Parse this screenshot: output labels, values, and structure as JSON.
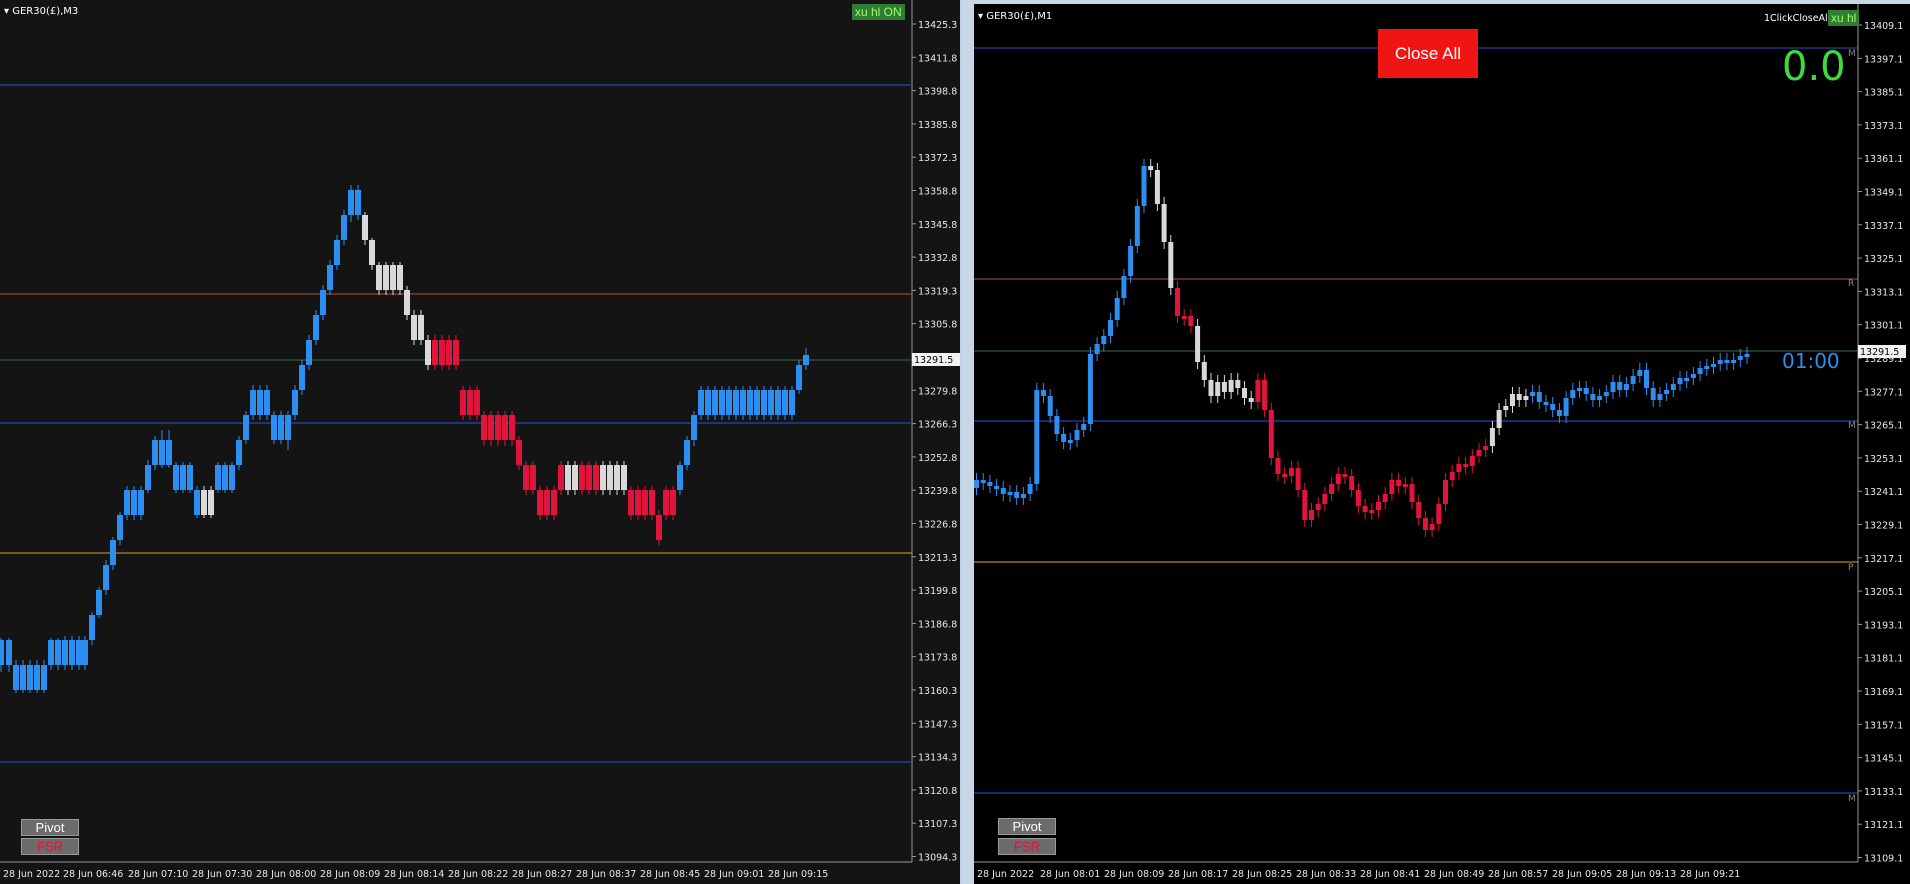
{
  "charts": [
    {
      "title": "GER30(£),M3",
      "bg": "#141414",
      "y_ticks": [
        "13425.3",
        "13411.8",
        "13398.8",
        "13385.8",
        "13372.3",
        "13358.8",
        "13345.8",
        "13332.8",
        "13319.3",
        "13305.8",
        "13291.5",
        "13279.8",
        "13266.3",
        "13252.8",
        "13239.8",
        "13226.8",
        "13213.3",
        "13199.8",
        "13186.8",
        "13173.8",
        "13160.3",
        "13147.3",
        "13134.3",
        "13120.8",
        "13107.3",
        "13094.3"
      ],
      "price_label": "13291.5",
      "x_ticks": [
        "28 Jun 2022",
        "28 Jun 06:46",
        "28 Jun 07:10",
        "28 Jun 07:30",
        "28 Jun 08:00",
        "28 Jun 08:09",
        "28 Jun 08:14",
        "28 Jun 08:22",
        "28 Jun 08:27",
        "28 Jun 08:37",
        "28 Jun 08:45",
        "28 Jun 09:01",
        "28 Jun 09:15"
      ],
      "buttons": {
        "pivot": "Pivot",
        "fsr": "FSR",
        "xu": "xu hl ON"
      }
    },
    {
      "title": "GER30(£),M1",
      "bg": "#000000",
      "y_ticks": [
        "13409.1",
        "13397.1",
        "13385.1",
        "13373.1",
        "13361.1",
        "13349.1",
        "13337.1",
        "13325.1",
        "13313.1",
        "13301.1",
        "13289.1",
        "13277.1",
        "13265.1",
        "13253.1",
        "13241.1",
        "13229.1",
        "13217.1",
        "13205.1",
        "13193.1",
        "13181.1",
        "13169.1",
        "13157.1",
        "13145.1",
        "13133.1",
        "13121.1",
        "13109.1"
      ],
      "price_label": "13291.5",
      "x_ticks": [
        "28 Jun 2022",
        "28 Jun 08:01",
        "28 Jun 08:09",
        "28 Jun 08:17",
        "28 Jun 08:25",
        "28 Jun 08:33",
        "28 Jun 08:41",
        "28 Jun 08:49",
        "28 Jun 08:57",
        "28 Jun 09:05",
        "28 Jun 09:13",
        "28 Jun 09:21"
      ],
      "buttons": {
        "pivot": "Pivot",
        "fsr": "FSR",
        "xu": "xu hl",
        "close_all": "Close All",
        "one_click": "1ClickCloseAll"
      },
      "profit": "0.0",
      "timer": "01:00",
      "line_markers": [
        "M",
        "R",
        "M",
        "P",
        "M"
      ]
    }
  ],
  "colors": {
    "bull": "#2b8ef0",
    "bear": "#e0143c",
    "neutral": "#d9d9d9",
    "blue_line": "#2a52d6",
    "red_line": "#c84646",
    "green_line": "#3f6e4c",
    "gold_line": "#d6a817",
    "profit": "#3ddc3d",
    "timer": "#2b8ef0"
  }
}
